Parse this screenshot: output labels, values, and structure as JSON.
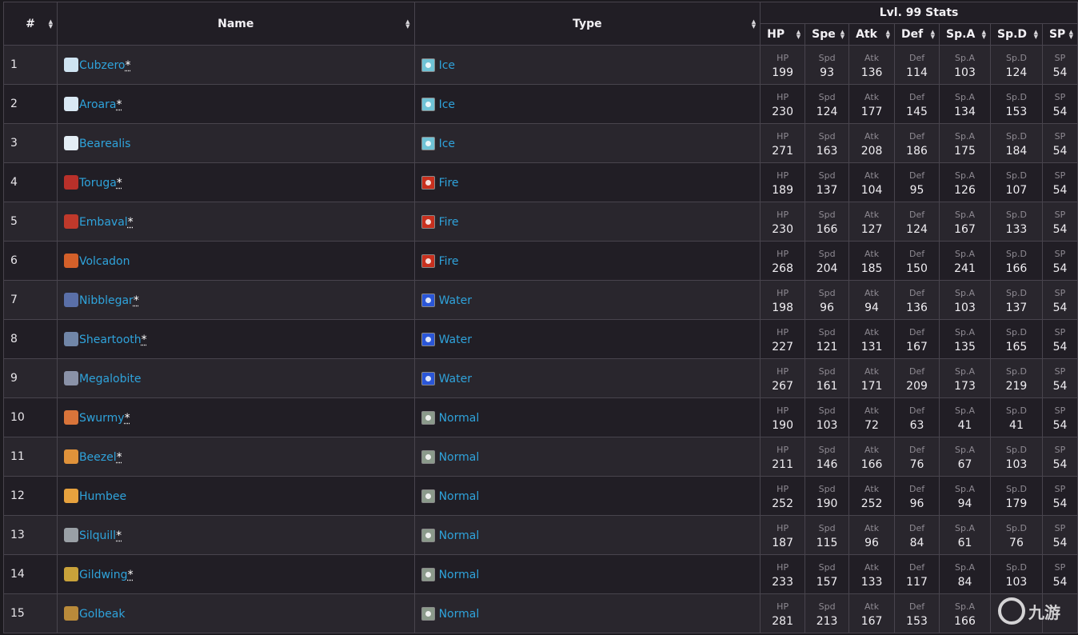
{
  "header": {
    "num": "#",
    "name": "Name",
    "type": "Type",
    "stats_group": "Lvl. 99 Stats",
    "stat_cols": [
      "HP",
      "Spe",
      "Atk",
      "Def",
      "Sp.A",
      "Sp.D",
      "SP"
    ]
  },
  "stat_labels": [
    "HP",
    "Spd",
    "Atk",
    "Def",
    "Sp.A",
    "Sp.D",
    "SP"
  ],
  "type_colors": {
    "Ice": "#6fc3d6",
    "Fire": "#c8301e",
    "Water": "#2a56d8",
    "Normal": "#8b9a8b"
  },
  "rows": [
    {
      "num": "1",
      "name": "Cubzero",
      "ast": "*",
      "sprite": "#cfe4f2",
      "type": "Ice",
      "stats": [
        "199",
        "93",
        "136",
        "114",
        "103",
        "124",
        "54"
      ]
    },
    {
      "num": "2",
      "name": "Aroara",
      "ast": "*",
      "sprite": "#d9e8f4",
      "type": "Ice",
      "stats": [
        "230",
        "124",
        "177",
        "145",
        "134",
        "153",
        "54"
      ]
    },
    {
      "num": "3",
      "name": "Bearealis",
      "ast": "",
      "sprite": "#e4eef6",
      "type": "Ice",
      "stats": [
        "271",
        "163",
        "208",
        "186",
        "175",
        "184",
        "54"
      ]
    },
    {
      "num": "4",
      "name": "Toruga",
      "ast": "*",
      "sprite": "#b8302a",
      "type": "Fire",
      "stats": [
        "189",
        "137",
        "104",
        "95",
        "126",
        "107",
        "54"
      ]
    },
    {
      "num": "5",
      "name": "Embaval",
      "ast": "*",
      "sprite": "#c0392b",
      "type": "Fire",
      "stats": [
        "230",
        "166",
        "127",
        "124",
        "167",
        "133",
        "54"
      ]
    },
    {
      "num": "6",
      "name": "Volcadon",
      "ast": "",
      "sprite": "#d4602a",
      "type": "Fire",
      "stats": [
        "268",
        "204",
        "185",
        "150",
        "241",
        "166",
        "54"
      ]
    },
    {
      "num": "7",
      "name": "Nibblegar",
      "ast": "*",
      "sprite": "#5a6fa8",
      "type": "Water",
      "stats": [
        "198",
        "96",
        "94",
        "136",
        "103",
        "137",
        "54"
      ]
    },
    {
      "num": "8",
      "name": "Sheartooth",
      "ast": "*",
      "sprite": "#7186a8",
      "type": "Water",
      "stats": [
        "227",
        "121",
        "131",
        "167",
        "135",
        "165",
        "54"
      ]
    },
    {
      "num": "9",
      "name": "Megalobite",
      "ast": "",
      "sprite": "#8a92a8",
      "type": "Water",
      "stats": [
        "267",
        "161",
        "171",
        "209",
        "173",
        "219",
        "54"
      ]
    },
    {
      "num": "10",
      "name": "Swurmy",
      "ast": "*",
      "sprite": "#d9743a",
      "type": "Normal",
      "stats": [
        "190",
        "103",
        "72",
        "63",
        "41",
        "41",
        "54"
      ]
    },
    {
      "num": "11",
      "name": "Beezel",
      "ast": "*",
      "sprite": "#e0923a",
      "type": "Normal",
      "stats": [
        "211",
        "146",
        "166",
        "76",
        "67",
        "103",
        "54"
      ]
    },
    {
      "num": "12",
      "name": "Humbee",
      "ast": "",
      "sprite": "#e7a23e",
      "type": "Normal",
      "stats": [
        "252",
        "190",
        "252",
        "96",
        "94",
        "179",
        "54"
      ]
    },
    {
      "num": "13",
      "name": "Silquill",
      "ast": "*",
      "sprite": "#9aa0a6",
      "type": "Normal",
      "stats": [
        "187",
        "115",
        "96",
        "84",
        "61",
        "76",
        "54"
      ]
    },
    {
      "num": "14",
      "name": "Gildwing",
      "ast": "*",
      "sprite": "#c9a23a",
      "type": "Normal",
      "stats": [
        "233",
        "157",
        "133",
        "117",
        "84",
        "103",
        "54"
      ]
    },
    {
      "num": "15",
      "name": "Golbeak",
      "ast": "",
      "sprite": "#b98a3a",
      "type": "Normal",
      "stats": [
        "281",
        "213",
        "167",
        "153",
        "166",
        "",
        ""
      ]
    }
  ]
}
